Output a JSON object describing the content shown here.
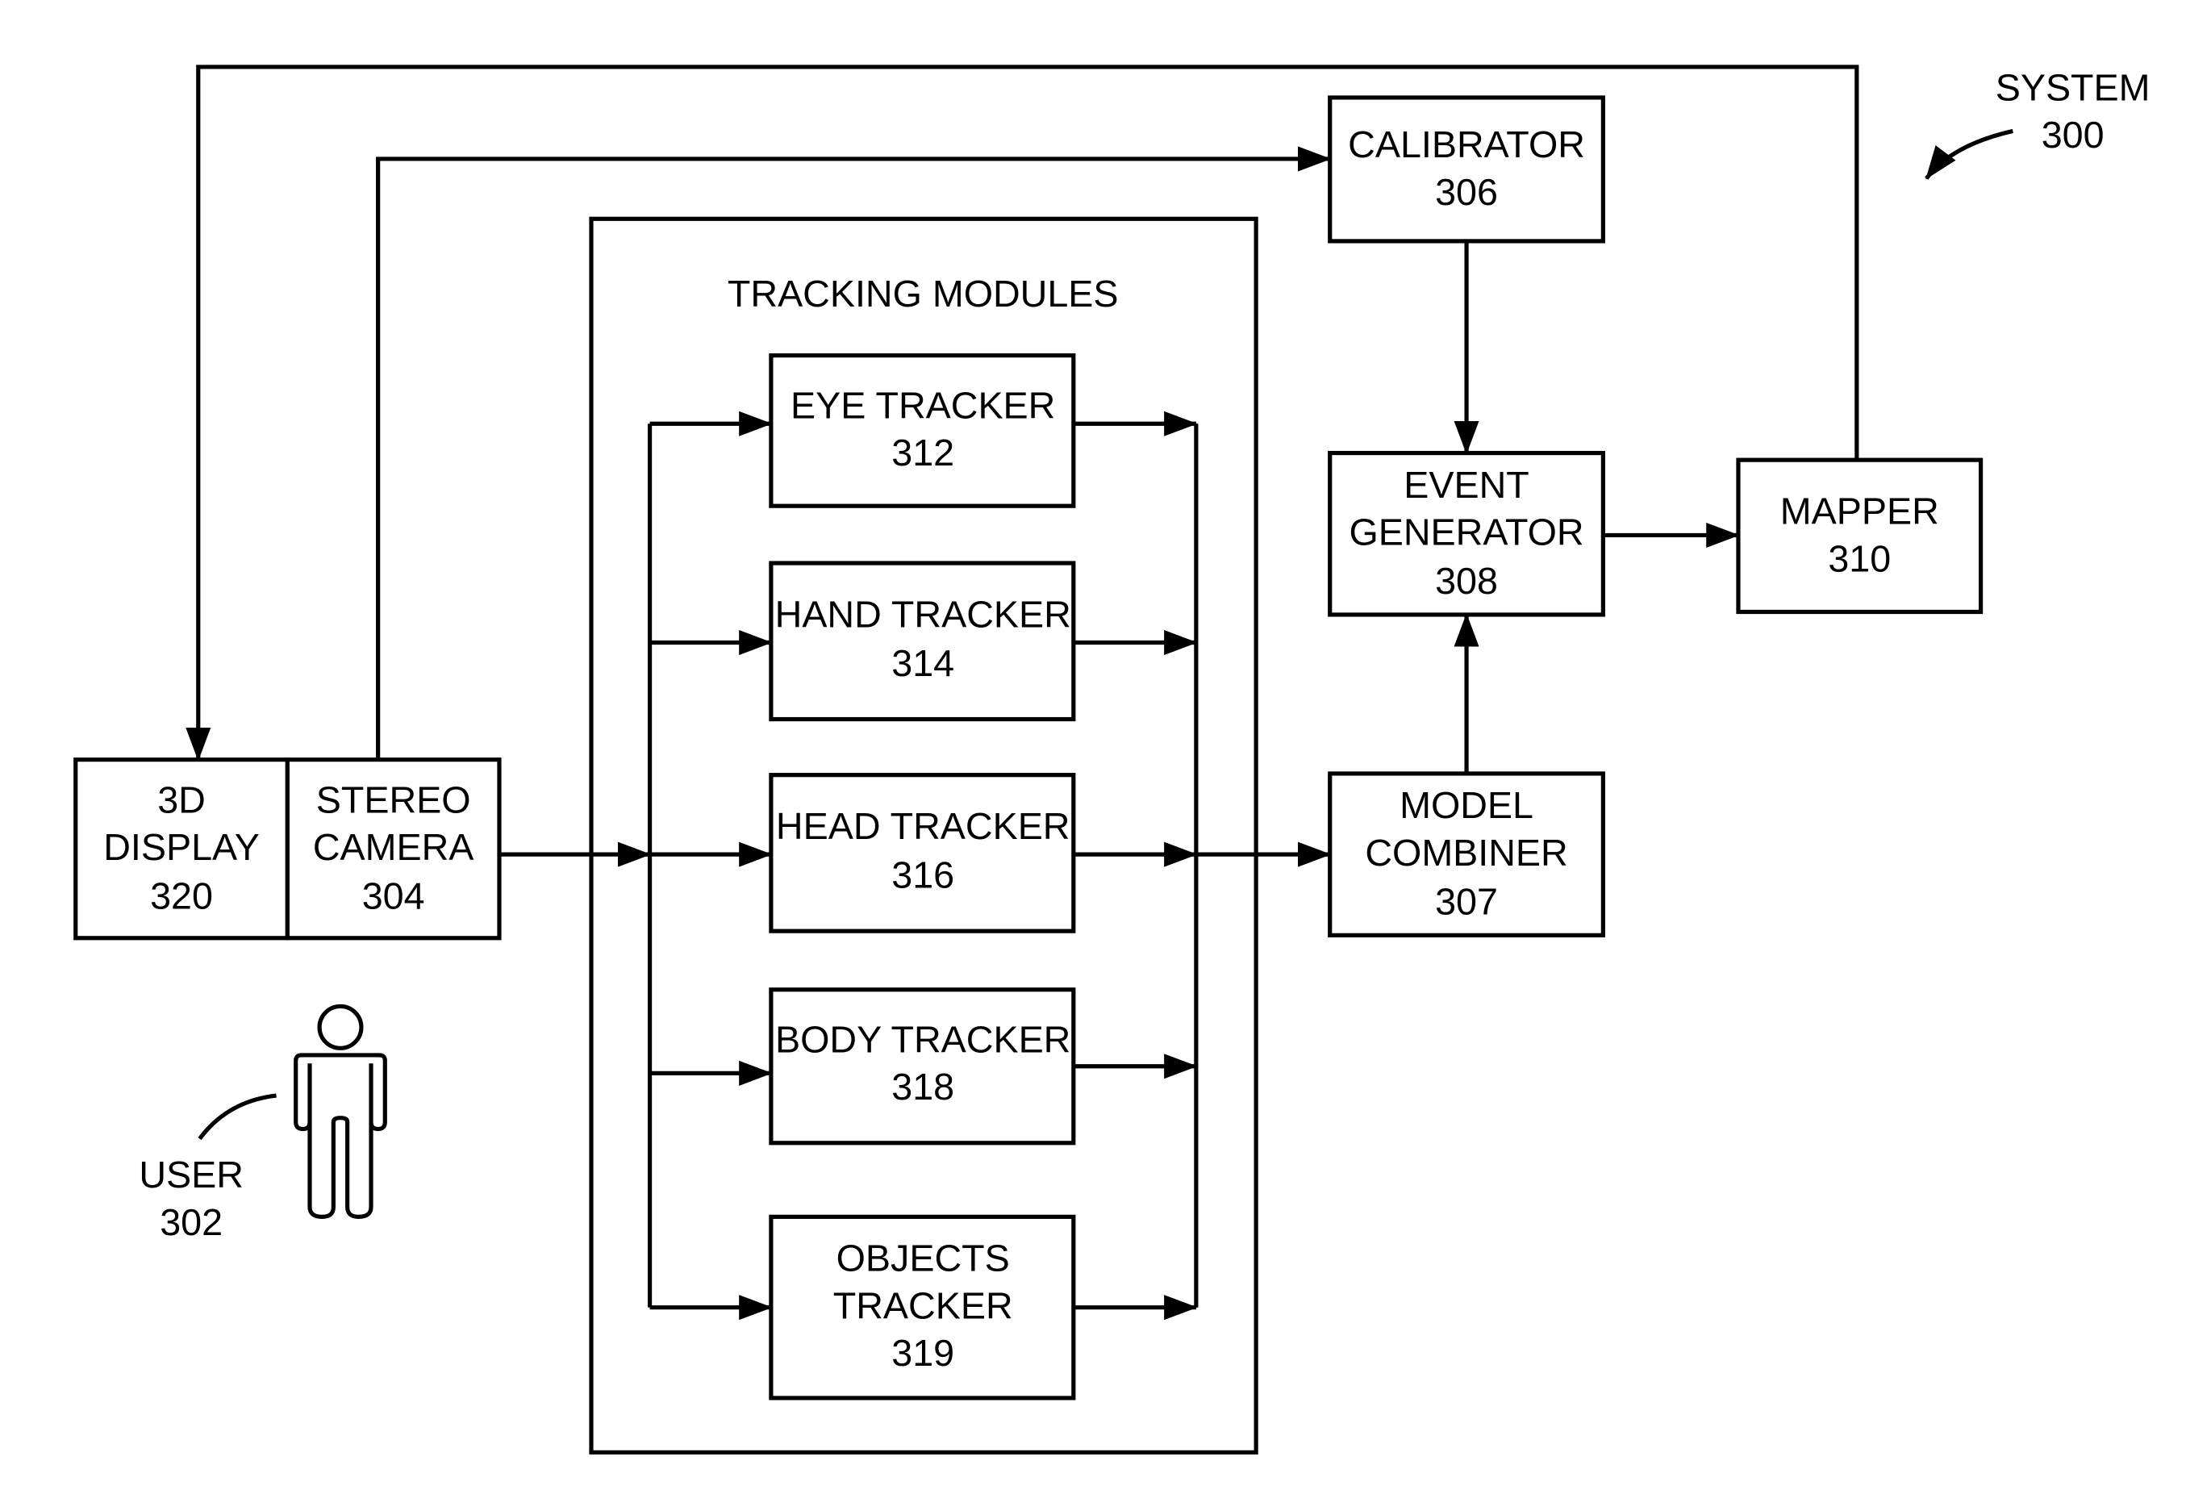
{
  "figure": {
    "system_label": {
      "line1": "SYSTEM",
      "line2": "300"
    },
    "user_label": {
      "line1": "USER",
      "line2": "302"
    },
    "tracking_modules_title": "TRACKING MODULES",
    "display_camera": {
      "display": {
        "line1": "3D",
        "line2": "DISPLAY",
        "line3": "320"
      },
      "camera": {
        "line1": "STEREO",
        "line2": "CAMERA",
        "line3": "304"
      }
    },
    "trackers": [
      {
        "lines": [
          "EYE TRACKER",
          "312"
        ]
      },
      {
        "lines": [
          "HAND TRACKER",
          "314"
        ]
      },
      {
        "lines": [
          "HEAD TRACKER",
          "316"
        ]
      },
      {
        "lines": [
          "BODY TRACKER",
          "318"
        ]
      },
      {
        "lines": [
          "OBJECTS",
          "TRACKER",
          "319"
        ]
      }
    ],
    "calibrator": {
      "line1": "CALIBRATOR",
      "line2": "306"
    },
    "event_generator": {
      "line1": "EVENT",
      "line2": "GENERATOR",
      "line3": "308"
    },
    "model_combiner": {
      "line1": "MODEL",
      "line2": "COMBINER",
      "line3": "307"
    },
    "mapper": {
      "line1": "MAPPER",
      "line2": "310"
    }
  }
}
